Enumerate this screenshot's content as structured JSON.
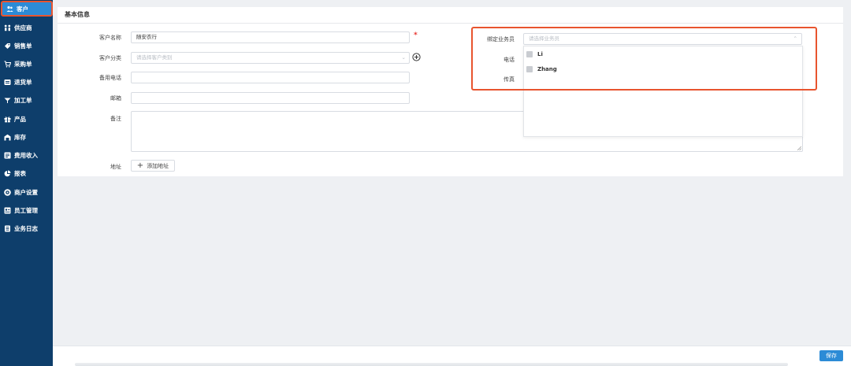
{
  "sidebar": {
    "items": [
      {
        "label": "客户",
        "icon": "users-icon",
        "active": true
      },
      {
        "label": "供应商",
        "icon": "supplier-icon"
      },
      {
        "label": "销售单",
        "icon": "tag-icon"
      },
      {
        "label": "采购单",
        "icon": "cart-icon"
      },
      {
        "label": "退货单",
        "icon": "return-icon"
      },
      {
        "label": "加工单",
        "icon": "tools-icon"
      },
      {
        "label": "产品",
        "icon": "gift-icon"
      },
      {
        "label": "库存",
        "icon": "warehouse-icon"
      },
      {
        "label": "费用收入",
        "icon": "ledger-icon"
      },
      {
        "label": "报表",
        "icon": "pie-chart-icon"
      },
      {
        "label": "商户设置",
        "icon": "gear-icon"
      },
      {
        "label": "员工管理",
        "icon": "staff-icon"
      },
      {
        "label": "业务日志",
        "icon": "log-icon"
      }
    ]
  },
  "section": {
    "title": "基本信息"
  },
  "form": {
    "customer_name": {
      "label": "客户名称",
      "value": "随安衣行",
      "required_mark": "*"
    },
    "customer_category": {
      "label": "客户分类",
      "placeholder": "请选择客户类别"
    },
    "backup_phone": {
      "label": "备用电话",
      "value": ""
    },
    "email": {
      "label": "邮箱",
      "value": ""
    },
    "remark": {
      "label": "备注",
      "value": ""
    },
    "address": {
      "label": "地址",
      "add_button": "添加地址"
    },
    "salesperson": {
      "label": "绑定业务员",
      "placeholder": "请选择业务员",
      "options": [
        "Li",
        "Zhang"
      ]
    },
    "phone": {
      "label": "电话"
    },
    "fax": {
      "label": "传真"
    }
  },
  "footer": {
    "save_label": "保存"
  },
  "colors": {
    "sidebar_bg": "#0e3e6b",
    "accent": "#2c8bd6",
    "highlight": "#e8542e",
    "required": "#e8342e"
  }
}
